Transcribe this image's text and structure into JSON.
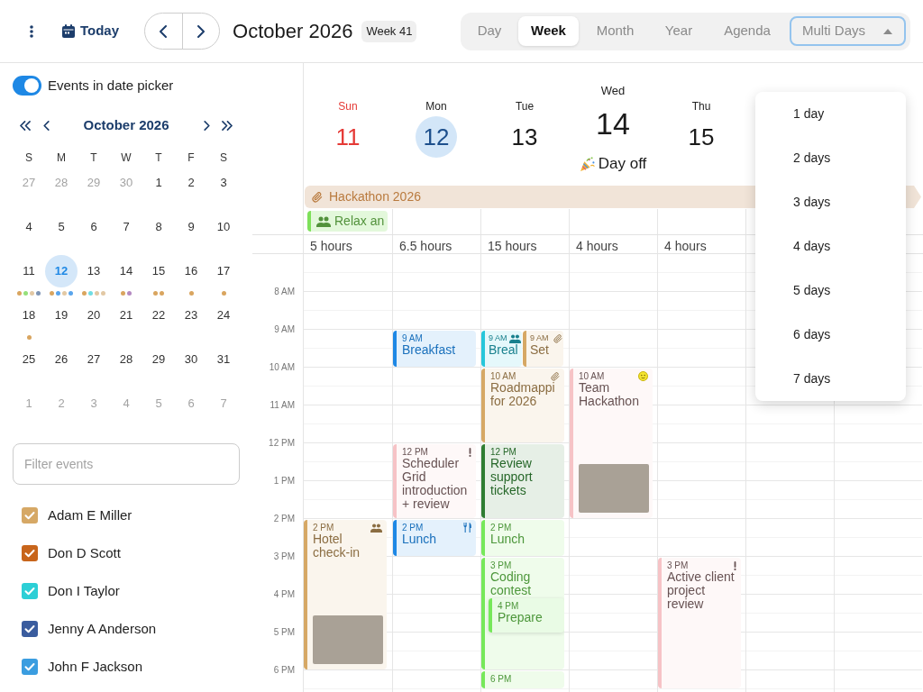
{
  "toolbar": {
    "today": "Today",
    "title": "October 2026",
    "week_badge": "Week 41",
    "views": [
      {
        "label": "Day",
        "selected": false
      },
      {
        "label": "Week",
        "selected": true
      },
      {
        "label": "Month",
        "selected": false
      },
      {
        "label": "Year",
        "selected": false
      },
      {
        "label": "Agenda",
        "selected": false
      }
    ],
    "multi_days": {
      "label": "Multi Days",
      "expanded": true,
      "options": [
        "1 day",
        "2 days",
        "3 days",
        "4 days",
        "5 days",
        "6 days",
        "7 days"
      ]
    }
  },
  "sidebar": {
    "toggle": {
      "label": "Events in date picker",
      "on": true
    },
    "mini_calendar": {
      "title": "October 2026",
      "weekdays": [
        "S",
        "M",
        "T",
        "W",
        "T",
        "F",
        "S"
      ],
      "weeks": [
        [
          {
            "day": "27",
            "outside": true,
            "selected": false
          },
          {
            "day": "28",
            "outside": true,
            "selected": false
          },
          {
            "day": "29",
            "outside": true,
            "selected": false
          },
          {
            "day": "30",
            "outside": true,
            "selected": false
          },
          {
            "day": "1",
            "outside": false,
            "selected": false
          },
          {
            "day": "2",
            "outside": false,
            "selected": false
          },
          {
            "day": "3",
            "outside": false,
            "selected": false
          }
        ],
        [
          {
            "day": "4",
            "outside": false,
            "selected": false
          },
          {
            "day": "5",
            "outside": false,
            "selected": false
          },
          {
            "day": "6",
            "outside": false,
            "selected": false
          },
          {
            "day": "7",
            "outside": false,
            "selected": false
          },
          {
            "day": "8",
            "outside": false,
            "selected": false
          },
          {
            "day": "9",
            "outside": false,
            "selected": false
          },
          {
            "day": "10",
            "outside": false,
            "selected": false
          }
        ],
        [
          {
            "day": "11",
            "outside": false,
            "selected": false,
            "dots": [
              {
                "color": "#d9a55f"
              },
              {
                "color": "#95e07a"
              },
              {
                "color": "#e2c8a4"
              },
              {
                "color": "#7f95b5"
              }
            ]
          },
          {
            "day": "12",
            "outside": false,
            "selected": true,
            "dots": [
              {
                "color": "#d9a55f"
              },
              {
                "color": "#5aa5ec"
              },
              {
                "color": "#e2c8a4"
              },
              {
                "color": "#5aa5ec"
              }
            ]
          },
          {
            "day": "13",
            "outside": false,
            "selected": false,
            "dots": [
              {
                "color": "#d9a55f"
              },
              {
                "color": "#6fdde3"
              },
              {
                "color": "#e2c8a4"
              },
              {
                "color": "#e2c8a4"
              }
            ]
          },
          {
            "day": "14",
            "outside": false,
            "selected": false,
            "dots": [
              {
                "color": "#d9a55f"
              },
              {
                "color": "#b48ac2"
              }
            ]
          },
          {
            "day": "15",
            "outside": false,
            "selected": false,
            "dots": [
              {
                "color": "#d9a55f"
              },
              {
                "color": "#d9a55f"
              }
            ]
          },
          {
            "day": "16",
            "outside": false,
            "selected": false,
            "dots": [
              {
                "color": "#d9a55f"
              }
            ]
          },
          {
            "day": "17",
            "outside": false,
            "selected": false,
            "dots": [
              {
                "color": "#d9a55f"
              }
            ]
          }
        ],
        [
          {
            "day": "18",
            "outside": false,
            "selected": false,
            "dots": [
              {
                "color": "#d9a55f"
              }
            ]
          },
          {
            "day": "19",
            "outside": false,
            "selected": false
          },
          {
            "day": "20",
            "outside": false,
            "selected": false
          },
          {
            "day": "21",
            "outside": false,
            "selected": false
          },
          {
            "day": "22",
            "outside": false,
            "selected": false
          },
          {
            "day": "23",
            "outside": false,
            "selected": false
          },
          {
            "day": "24",
            "outside": false,
            "selected": false
          }
        ],
        [
          {
            "day": "25",
            "outside": false,
            "selected": false
          },
          {
            "day": "26",
            "outside": false,
            "selected": false
          },
          {
            "day": "27",
            "outside": false,
            "selected": false
          },
          {
            "day": "28",
            "outside": false,
            "selected": false
          },
          {
            "day": "29",
            "outside": false,
            "selected": false
          },
          {
            "day": "30",
            "outside": false,
            "selected": false
          },
          {
            "day": "31",
            "outside": false,
            "selected": false
          }
        ],
        [
          {
            "day": "1",
            "outside": true,
            "selected": false
          },
          {
            "day": "2",
            "outside": true,
            "selected": false
          },
          {
            "day": "3",
            "outside": true,
            "selected": false
          },
          {
            "day": "4",
            "outside": true,
            "selected": false
          },
          {
            "day": "5",
            "outside": true,
            "selected": false
          },
          {
            "day": "6",
            "outside": true,
            "selected": false
          },
          {
            "day": "7",
            "outside": true,
            "selected": false
          }
        ]
      ]
    },
    "filter": {
      "placeholder": "Filter events"
    },
    "people": [
      {
        "name": "Adam E Miller",
        "checked": true,
        "color": "#d6a865"
      },
      {
        "name": "Don D Scott",
        "checked": true,
        "color": "#c8651b"
      },
      {
        "name": "Don I Taylor",
        "checked": true,
        "color": "#2ccfd6"
      },
      {
        "name": "Jenny A Anderson",
        "checked": true,
        "color": "#3a5c9e"
      },
      {
        "name": "John F Jackson",
        "checked": true,
        "color": "#3a9de0"
      }
    ]
  },
  "week_view": {
    "banners": [
      {
        "title": "Hackathon 2026",
        "color": "#b97a3e",
        "kind": "attachment",
        "continues": true
      }
    ],
    "days": [
      {
        "name": "Sun",
        "date": "11",
        "weekend": true,
        "today": false,
        "total": "5 hours",
        "all_day": [
          {
            "title": "Relax an",
            "color": "#7ee05a",
            "kind": "group"
          }
        ],
        "events": [
          {
            "time": "2 PM",
            "title": "Hotel check-in",
            "color": "#d6a865",
            "kind": "group",
            "photo": true
          }
        ]
      },
      {
        "name": "Mon",
        "date": "12",
        "weekend": false,
        "today": true,
        "total": "6.5 hours",
        "events": [
          {
            "time": "9 AM",
            "title": "Breakfast",
            "color": "#1e88e5",
            "kind": "plain",
            "photo": false
          },
          {
            "time": "12 PM",
            "title": "Scheduler Grid introduction + review",
            "color": "#f6c3c6",
            "kind": "priority",
            "photo": false
          },
          {
            "time": "2 PM",
            "title": "Lunch",
            "color": "#1e88e5",
            "kind": "meal",
            "photo": false
          }
        ]
      },
      {
        "name": "Tue",
        "date": "13",
        "weekend": false,
        "today": false,
        "total": "15 hours",
        "events": [
          {
            "time": "9 AM",
            "title": "Breal",
            "color": "#26c6da",
            "kind": "group",
            "photo": false
          },
          {
            "time": "9 AM",
            "title": "Set",
            "color": "#d6a865",
            "kind": "attachment",
            "photo": false
          },
          {
            "time": "10 AM",
            "title": "Roadmappi for 2026",
            "color": "#d6a865",
            "kind": "attachment",
            "photo": false
          },
          {
            "time": "12 PM",
            "title": "Review support tickets",
            "color": "#2e7d32",
            "kind": "plain",
            "photo": false
          },
          {
            "time": "2 PM",
            "title": "Lunch",
            "color": "#76e85a",
            "kind": "plain",
            "photo": false
          },
          {
            "time": "3 PM",
            "title": "Coding contest",
            "color": "#76e85a",
            "kind": "plain",
            "photo": false
          },
          {
            "time": "4 PM",
            "title": "Prepare",
            "color": "#76e85a",
            "kind": "plain",
            "photo": false
          },
          {
            "time": "6 PM",
            "color": "#76e85a",
            "kind": "plain",
            "photo": false
          }
        ]
      },
      {
        "name": "Wed",
        "date": "14",
        "weekend": false,
        "today": false,
        "note": "Day off",
        "total": "4 hours",
        "events": [
          {
            "time": "10 AM",
            "title": "Team Hackathon",
            "color": "#f6c3c6",
            "kind": "mood",
            "photo": true
          }
        ]
      },
      {
        "name": "Thu",
        "date": "15",
        "weekend": false,
        "today": false,
        "total": "4 hours",
        "events": [
          {
            "time": "3 PM",
            "title": "Active client project review",
            "color": "#f6c3c6",
            "kind": "priority",
            "photo": false
          }
        ]
      }
    ],
    "time_labels": [
      "8 AM",
      "9 AM",
      "10 AM",
      "11 AM",
      "12 PM",
      "1 PM",
      "2 PM",
      "3 PM",
      "4 PM",
      "5 PM",
      "6 PM"
    ]
  }
}
